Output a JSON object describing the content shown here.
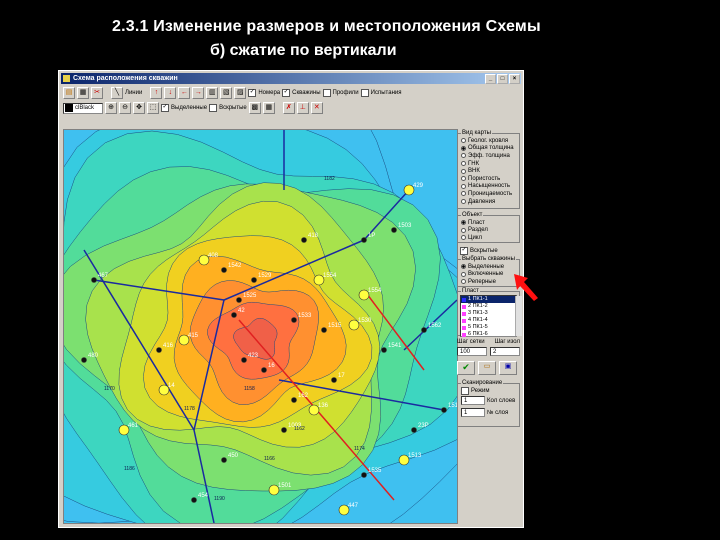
{
  "slide": {
    "title": "2.3.1 Изменение размеров и местоположения Схемы",
    "subtitle": "б) сжатие по вертикали"
  },
  "window": {
    "title": "Схема расположения скважин",
    "buttons": [
      "_",
      "□",
      "×"
    ]
  },
  "toolbar1": {
    "lines_label": "Линии",
    "checks": [
      {
        "label": "Номера",
        "checked": true
      },
      {
        "label": "Скважины",
        "checked": true
      },
      {
        "label": "Профили",
        "checked": false
      },
      {
        "label": "Испытания",
        "checked": false
      }
    ]
  },
  "toolbar2": {
    "color_combo": "clBlack",
    "selected_label": "Выделенные",
    "selected_checked": true,
    "opened_label": "Вскрытые",
    "opened_checked": false
  },
  "panel": {
    "map_type": {
      "caption": "Вид карты",
      "options": [
        "Геолог. кровля",
        "Общая толщина",
        "Эфф. толщина",
        "ГНК",
        "ВНК",
        "Пористость",
        "Насыщенность",
        "Проницаемость",
        "Давления"
      ],
      "selected": 1
    },
    "object": {
      "caption": "Объект",
      "options": [
        "Пласт",
        "Раздел",
        "Цикл"
      ],
      "selected": 0
    },
    "opened_check": "Вскрытые",
    "choose_wells": {
      "caption": "Выбрать скважины",
      "options": [
        "Выделенные",
        "Включенные",
        "Реперные"
      ],
      "selected": 0
    },
    "layer": {
      "caption": "Пласт",
      "items": [
        {
          "label": "1 ПК1-1",
          "color": "#2a2aff"
        },
        {
          "label": "2 ПК1-2",
          "color": "#ff40ff"
        },
        {
          "label": "3 ПК1-3",
          "color": "#ff40ff"
        },
        {
          "label": "4 ПК1-4",
          "color": "#ff40ff"
        },
        {
          "label": "5 ПК1-5",
          "color": "#ff40ff"
        },
        {
          "label": "6 ПК1-6",
          "color": "#ff40ff"
        }
      ],
      "selected": 0
    },
    "grid_step_label": "Шаг сетки",
    "iso_step_label": "Шаг изол",
    "grid_step_value": "100",
    "iso_step_value": "2",
    "scan": {
      "caption": "Сканирование",
      "mode_label": "Режим",
      "layers_count_label": "Кол слоев",
      "layers_count_value": "1",
      "layer_num_label": "№ слоя",
      "layer_num_value": "1"
    }
  },
  "map": {
    "well_labels": [
      "429",
      "1P",
      "418",
      "408",
      "1542",
      "1529",
      "1554",
      "1533",
      "1515",
      "1530",
      "1541",
      "1562",
      "1554",
      "42",
      "423",
      "415",
      "416",
      "162",
      "136",
      "23P",
      "1515",
      "1513",
      "1535",
      "1003",
      "447",
      "450",
      "454",
      "461",
      "467",
      "480",
      "1501",
      "1503",
      "1525",
      "14",
      "17",
      "16"
    ],
    "contour_labels": [
      "1190",
      "1186",
      "1182",
      "1178",
      "1174",
      "1170",
      "1166",
      "1162",
      "1158"
    ]
  }
}
